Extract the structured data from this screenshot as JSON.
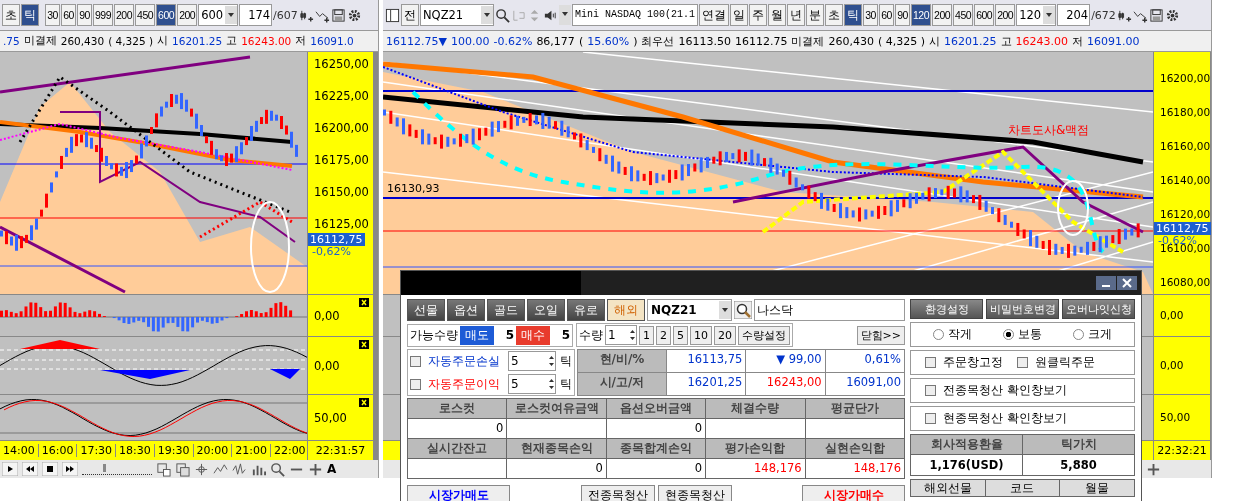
{
  "left_window": {
    "toolbar": {
      "periods": [
        {
          "label": "초",
          "selected": false
        },
        {
          "label": "틱",
          "selected": true
        }
      ],
      "intervals": [
        {
          "label": "30",
          "selected": false
        },
        {
          "label": "60",
          "selected": false
        },
        {
          "label": "90",
          "selected": false
        },
        {
          "label": "999",
          "selected": false
        },
        {
          "label": "200",
          "selected": false
        },
        {
          "label": "450",
          "selected": false
        },
        {
          "label": "600",
          "selected": true
        },
        {
          "label": "200",
          "selected": false
        }
      ],
      "interval_value": "600",
      "count": "174",
      "total": "/607"
    },
    "quote": [
      {
        "text": ".75",
        "kind": "low"
      },
      {
        "text": "미결제",
        "kind": "label"
      },
      {
        "text": "260,430",
        "kind": "value"
      },
      {
        "text": "( 4,325 )",
        "kind": "value"
      },
      {
        "text": "시",
        "kind": "label"
      },
      {
        "text": "16201.25",
        "kind": "low"
      },
      {
        "text": "고",
        "kind": "label"
      },
      {
        "text": "16243.00",
        "kind": "high"
      },
      {
        "text": "저",
        "kind": "label"
      },
      {
        "text": "16091.0",
        "kind": "low"
      }
    ],
    "price_axis": [
      "16250,00",
      "16225,00",
      "16200,00",
      "16175,00",
      "16150,00",
      "16125,00"
    ],
    "price_marker": {
      "price": "16112,75",
      "change": "-0,62%"
    },
    "indicator_axes": [
      "0,00",
      "0,00",
      "50,00"
    ],
    "time_axis": [
      "14:00",
      "16:00",
      "17:30",
      "18:30",
      "19:30",
      "20:00",
      "21:00",
      "22:00"
    ],
    "time_now": "22:31:57",
    "font_button": "A",
    "speed_slider": {
      "level": 0.3
    }
  },
  "right_window": {
    "toolbar": {
      "symbol": "전",
      "code": "NQZ21",
      "name": "Mini NASDAQ 100(21.1",
      "link": "연결",
      "periods": [
        {
          "label": "일",
          "selected": false
        },
        {
          "label": "주",
          "selected": false
        },
        {
          "label": "월",
          "selected": false
        },
        {
          "label": "년",
          "selected": false
        },
        {
          "label": "분",
          "selected": false
        },
        {
          "label": "초",
          "selected": false
        },
        {
          "label": "틱",
          "selected": true
        }
      ],
      "intervals": [
        {
          "label": "30",
          "selected": false
        },
        {
          "label": "60",
          "selected": false
        },
        {
          "label": "90",
          "selected": false
        },
        {
          "label": "120",
          "selected": true
        },
        {
          "label": "200",
          "selected": false
        },
        {
          "label": "450",
          "selected": false
        },
        {
          "label": "600",
          "selected": false
        },
        {
          "label": "200",
          "selected": false
        }
      ],
      "interval_value": "120",
      "count": "204",
      "total": "/672"
    },
    "quote": [
      {
        "text": "16112.75▼",
        "kind": "low"
      },
      {
        "text": "100.00",
        "kind": "low"
      },
      {
        "text": "-0.62%",
        "kind": "low"
      },
      {
        "text": "86,177",
        "kind": "value"
      },
      {
        "text": "(",
        "kind": "value"
      },
      {
        "text": "15.60%",
        "kind": "low"
      },
      {
        "text": ")",
        "kind": "value"
      },
      {
        "text": "최우선",
        "kind": "label"
      },
      {
        "text": "16113.50",
        "kind": "value"
      },
      {
        "text": "16112.75",
        "kind": "value"
      },
      {
        "text": "미결제",
        "kind": "label"
      },
      {
        "text": "260,430",
        "kind": "value"
      },
      {
        "text": "( 4,325 )",
        "kind": "value"
      },
      {
        "text": "시",
        "kind": "label"
      },
      {
        "text": "16201.25",
        "kind": "low"
      },
      {
        "text": "고",
        "kind": "label"
      },
      {
        "text": "16243.00",
        "kind": "high"
      },
      {
        "text": "저",
        "kind": "label"
      },
      {
        "text": "16091.00",
        "kind": "low"
      }
    ],
    "price_axis": [
      "16200,00",
      "16180,00",
      "16160,00",
      "16140,00",
      "16120,00",
      "16100,00",
      "16080,00"
    ],
    "price_marker": {
      "price": "16112,75",
      "change": "-0,62%"
    },
    "chart_labels": {
      "level": "16130,93",
      "annotation": "차트도사&맥점"
    },
    "indicator_axes": [
      "0,00",
      "0,00",
      "50,00"
    ],
    "time_now": "22:32:21"
  },
  "order_window": {
    "tabs": [
      {
        "label": "선물",
        "selected": false
      },
      {
        "label": "옵션",
        "selected": false
      },
      {
        "label": "골드",
        "selected": false
      },
      {
        "label": "오일",
        "selected": false
      },
      {
        "label": "유로",
        "selected": false
      },
      {
        "label": "해외",
        "selected": true
      }
    ],
    "code": "NQZ21",
    "name": "나스닥",
    "available": {
      "label": "가능수량",
      "sell_label": "매도",
      "sell": "5",
      "buy_label": "매수",
      "buy": "5"
    },
    "quantity": {
      "label": "수량",
      "value": "1",
      "presets": [
        "1",
        "2",
        "5",
        "10",
        "20"
      ],
      "setting": "수량설정",
      "close": "닫힘>>"
    },
    "auto_orders": [
      {
        "label": "자동주문손실",
        "checked": false,
        "value": "5",
        "unit": "틱",
        "kind": "loss"
      },
      {
        "label": "자동주문이익",
        "checked": false,
        "value": "5",
        "unit": "틱",
        "kind": "profit"
      }
    ],
    "price_rows": [
      {
        "label": "현/비/%",
        "cells": [
          {
            "text": "16113,75",
            "kind": "low"
          },
          {
            "text": "▼ 99,00",
            "kind": "low"
          },
          {
            "text": "0,61%",
            "kind": "low"
          }
        ]
      },
      {
        "label": "시/고/저",
        "cells": [
          {
            "text": "16201,25",
            "kind": "low"
          },
          {
            "text": "16243,00",
            "kind": "high"
          },
          {
            "text": "16091,00",
            "kind": "low"
          }
        ]
      }
    ],
    "grid": [
      {
        "headers": [
          "로스컷",
          "로스컷여유금액",
          "옵션오버금액",
          "체결수량",
          "평균단가"
        ],
        "values": [
          {
            "text": "0",
            "kind": "num"
          },
          {
            "kind": "num"
          },
          {
            "text": "0",
            "kind": "num"
          },
          {
            "kind": "num"
          },
          {
            "kind": "num"
          }
        ]
      },
      {
        "headers": [
          "실시간잔고",
          "현재종목손익",
          "종목합계손익",
          "평가손익합",
          "실현손익합"
        ],
        "values": [
          {
            "kind": "num"
          },
          {
            "text": "0",
            "kind": "num"
          },
          {
            "text": "0",
            "kind": "num"
          },
          {
            "text": "148,176",
            "kind": "pnl"
          },
          {
            "text": "148,176",
            "kind": "pnl"
          }
        ]
      }
    ],
    "actions": {
      "market_sell": "시장가매도",
      "close_all": "전종목청산",
      "close_current": "현종목청산",
      "market_buy": "시장가매수"
    },
    "settings_buttons": [
      "환경설정",
      "비밀번호변경",
      "오버나잇신청"
    ],
    "sizes": [
      {
        "label": "작게",
        "selected": false
      },
      {
        "label": "보통",
        "selected": true
      },
      {
        "label": "크게",
        "selected": false
      }
    ],
    "options_row": [
      {
        "label": "주문창고정",
        "checked": false
      },
      {
        "label": "원클릭주문",
        "checked": false
      }
    ],
    "options": [
      {
        "label": "전종목청산 확인창보기",
        "checked": false
      },
      {
        "label": "현종목청산 확인창보기",
        "checked": false
      }
    ],
    "rate_table": {
      "headers": [
        "회사적용환율",
        "틱가치"
      ],
      "values": [
        "1,176(USD)",
        "5,880"
      ]
    },
    "list_headers": [
      "해외선물",
      "코드",
      "월물"
    ]
  }
}
